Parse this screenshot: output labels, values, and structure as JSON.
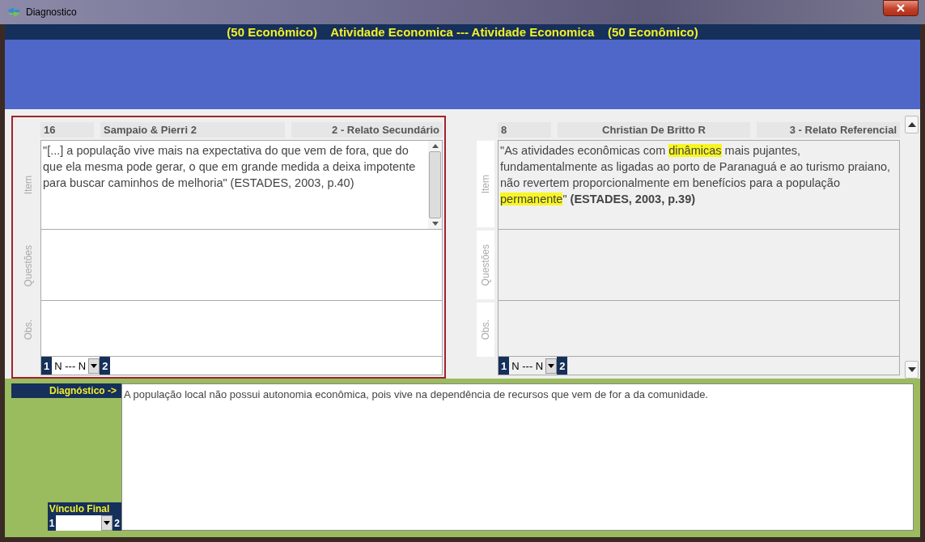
{
  "window": {
    "title": "Diagnostico"
  },
  "header": {
    "title": "(50 Econômico)    Atividade Economica --- Atividade Economica    (50 Econômico)"
  },
  "panels": [
    {
      "selected": true,
      "disabled": false,
      "item_scrollbar": true,
      "number": "16",
      "author": "Sampaio & Pierri 2",
      "type": "2 - Relato Secundário",
      "field_labels": [
        "Item",
        "Questões",
        "Obs."
      ],
      "item_segments": [
        {
          "text": "\"[...]  a população vive mais na expectativa do que vem de fora, que do que ela mesma pode gerar, o que em grande medida a deixa impotente para buscar caminhos de melhoria\" (ESTADES, 2003, p.40)",
          "highlighted": false
        }
      ],
      "link": {
        "from": "1",
        "value": "N --- N",
        "to": "2"
      }
    },
    {
      "selected": false,
      "disabled": true,
      "item_scrollbar": false,
      "number": "8",
      "author": "Christian De Britto R",
      "type": "3 - Relato Referencial",
      "field_labels": [
        "Item",
        "Questões",
        "Obs."
      ],
      "item_segments": [
        {
          "text": "\"As atividades econômicas com ",
          "highlighted": false
        },
        {
          "text": "dinâmicas",
          "highlighted": true
        },
        {
          "text": " mais pujantes, fundamentalmente as ligadas ao porto de Paranaguá e ao turismo praiano, não revertem proporcionalmente em benefícios para a população ",
          "highlighted": false
        },
        {
          "text": "permanente",
          "highlighted": true
        },
        {
          "text": "\" **(ESTADES, 2003, p.39)**",
          "highlighted": false
        }
      ],
      "link": {
        "from": "1",
        "value": "N --- N",
        "to": "2"
      }
    }
  ],
  "diagnosis": {
    "label": "Diagnóstico ->",
    "text": "A população local não possui autonomia econômica, pois vive na dependência de recursos que vem de for a da comunidade."
  },
  "final_link": {
    "label": "Vínculo Final",
    "from": "1",
    "to": "2"
  }
}
